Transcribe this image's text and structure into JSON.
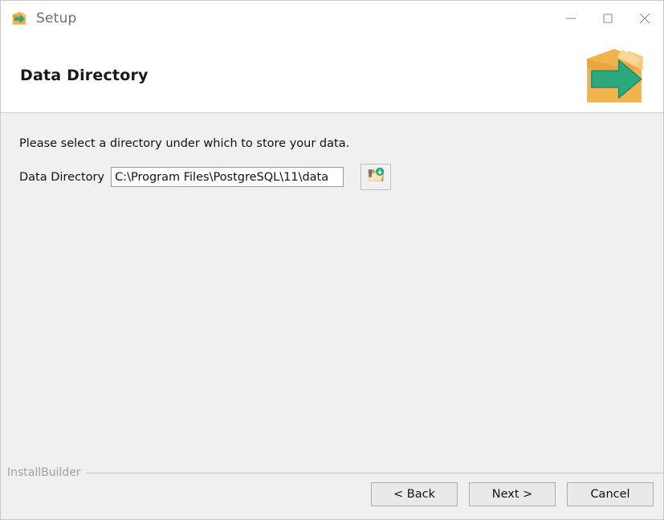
{
  "window": {
    "title": "Setup",
    "app_icon": "setup-box-arrow-icon",
    "controls": [
      {
        "name": "minimize",
        "glyph": "minimize-icon"
      },
      {
        "name": "maximize",
        "glyph": "maximize-icon"
      },
      {
        "name": "close",
        "glyph": "close-icon"
      }
    ]
  },
  "header": {
    "title": "Data Directory",
    "logo": "installer-box-arrow-logo"
  },
  "content": {
    "instruction": "Please select a directory under which to store your data.",
    "field": {
      "label": "Data Directory",
      "value": "C:\\Program Files\\PostgreSQL\\11\\data",
      "placeholder": "",
      "browse_icon": "folder-open-icon"
    }
  },
  "footer": {
    "brand": "InstallBuilder",
    "buttons": {
      "back": "< Back",
      "next": "Next >",
      "cancel": "Cancel"
    }
  },
  "colors": {
    "accent_box": "#f2b24c",
    "accent_arrow": "#2aa87e",
    "title_text": "#6e6e6e",
    "content_bg": "#f0f0f0",
    "brand_text": "#a0a0a0"
  }
}
